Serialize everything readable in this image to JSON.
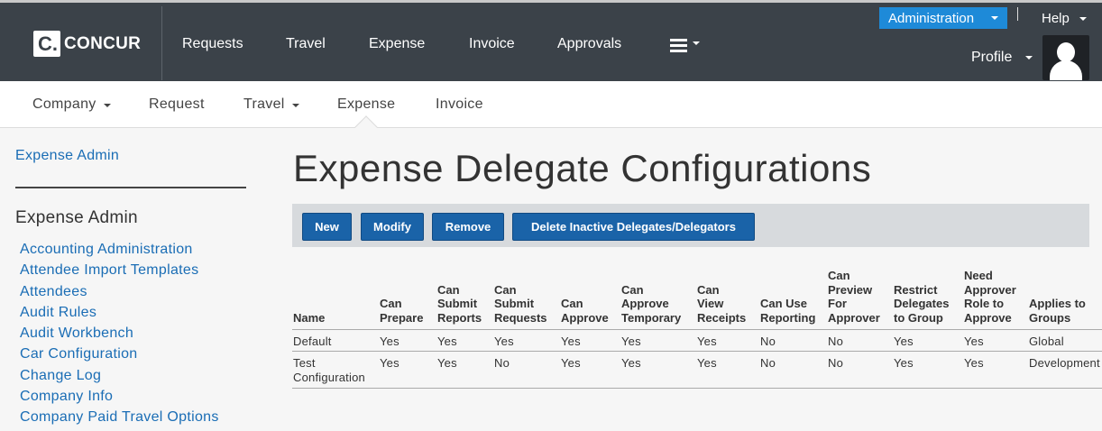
{
  "header": {
    "logo_text": "CONCUR",
    "logo_letter": "C.",
    "nav": [
      "Requests",
      "Travel",
      "Expense",
      "Invoice",
      "Approvals"
    ],
    "admin_label": "Administration",
    "help_label": "Help",
    "profile_label": "Profile"
  },
  "subnav": {
    "items": [
      "Company",
      "Request",
      "Travel",
      "Expense",
      "Invoice"
    ],
    "active": "Expense"
  },
  "sidebar": {
    "title_link": "Expense Admin",
    "heading": "Expense Admin",
    "links": [
      "Accounting Administration",
      "Attendee Import Templates",
      "Attendees",
      "Audit Rules",
      "Audit Workbench",
      "Car Configuration",
      "Change Log",
      "Company Info",
      "Company Paid Travel Options"
    ]
  },
  "main": {
    "title": "Expense Delegate Configurations",
    "buttons": [
      "New",
      "Modify",
      "Remove",
      "Delete Inactive Delegates/Delegators"
    ],
    "table": {
      "columns": [
        "Name",
        "Can\nPrepare",
        "Can\nSubmit\nReports",
        "Can\nSubmit\nRequests",
        "Can\nApprove",
        "Can\nApprove\nTemporary",
        "Can\nView\nReceipts",
        "Can Use\nReporting",
        "Can\nPreview\nFor\nApprover",
        "Restrict\nDelegates\nto Group",
        "Need\nApprover\nRole to\nApprove",
        "Applies to\nGroups"
      ],
      "rows": [
        [
          "Default",
          "Yes",
          "Yes",
          "Yes",
          "Yes",
          "Yes",
          "Yes",
          "No",
          "No",
          "Yes",
          "Yes",
          "Global"
        ],
        [
          "Test\nConfiguration",
          "Yes",
          "Yes",
          "No",
          "Yes",
          "Yes",
          "Yes",
          "No",
          "No",
          "Yes",
          "Yes",
          "Development"
        ]
      ]
    }
  }
}
